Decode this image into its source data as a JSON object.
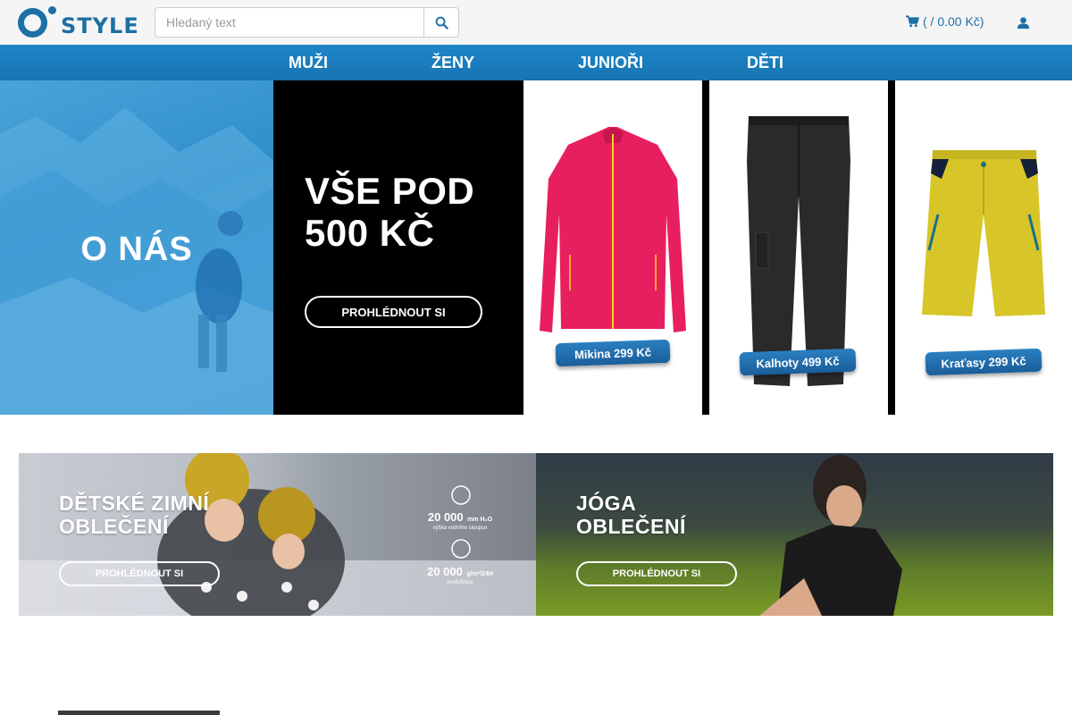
{
  "header": {
    "logo_text": "STYLE",
    "search": {
      "placeholder": "Hledaný text"
    },
    "cart_label": "( / 0.00 Kč)"
  },
  "nav": {
    "items": [
      {
        "label": "MUŽI"
      },
      {
        "label": "ŽENY"
      },
      {
        "label": "JUNIOŘI"
      },
      {
        "label": "DĚTI"
      }
    ]
  },
  "hero": {
    "about_title": "O NÁS",
    "promo_title_line1": "VŠE POD",
    "promo_title_line2": "500 KČ",
    "promo_button": "PROHLÉDNOUT SI",
    "products": [
      {
        "label": "Mikina 299 Kč",
        "color": "#e81f5e"
      },
      {
        "label": "Kalhoty 499 Kč",
        "color": "#2a2a2a"
      },
      {
        "label": "Kraťasy 299 Kč",
        "color": "#d8c629"
      }
    ]
  },
  "banners": {
    "kids": {
      "title_line1": "DĚTSKÉ ZIMNÍ",
      "title_line2": "OBLEČENÍ",
      "button": "PROHLÉDNOUT SI",
      "spec1_num": "20 000",
      "spec1_unit": "mm H₂O",
      "spec1_desc": "výška vodního sloupce",
      "spec2_num": "20 000",
      "spec2_unit": "g/m²/24H",
      "spec2_desc": "prodyšnost"
    },
    "yoga": {
      "title_line1": "JÓGA",
      "title_line2": "OBLEČENÍ",
      "button": "PROHLÉDNOUT SI"
    }
  },
  "colors": {
    "brand": "#1d6fa5",
    "nav": "#1e86c9"
  }
}
